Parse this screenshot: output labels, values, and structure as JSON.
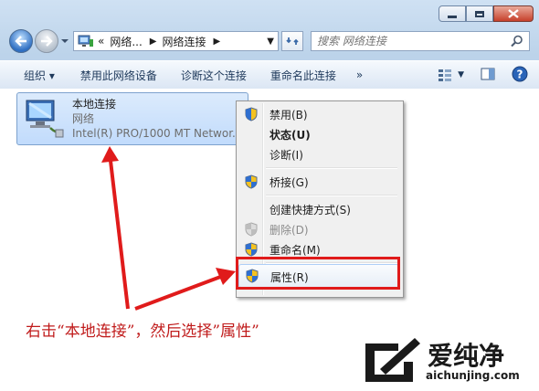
{
  "window": {
    "min_label": "",
    "max_label": "",
    "close_label": ""
  },
  "address": {
    "prefix": "«",
    "crumbs": [
      "网络...",
      "网络连接"
    ]
  },
  "search": {
    "placeholder": "搜索 网络连接"
  },
  "toolbar": {
    "organize": "组织 ▾",
    "disable": "禁用此网络设备",
    "diagnose": "诊断这个连接",
    "rename": "重命名此连接",
    "more": "»"
  },
  "connection": {
    "name": "本地连接",
    "network": "网络",
    "adapter": "Intel(R) PRO/1000 MT Networ..."
  },
  "menu": {
    "items": [
      {
        "label": "禁用(B)"
      },
      {
        "label": "状态(U)"
      },
      {
        "label": "诊断(I)"
      },
      {
        "label": "桥接(G)"
      },
      {
        "label": "创建快捷方式(S)"
      },
      {
        "label": "删除(D)"
      },
      {
        "label": "重命名(M)"
      },
      {
        "label": "属性(R)"
      }
    ]
  },
  "annotation": {
    "text": "右击“本地连接”，然后选择”属性”"
  },
  "watermark": {
    "brand": "爱纯净",
    "url": "aichunjing.com"
  },
  "colors": {
    "annotation_red": "#e01b1b",
    "accent_blue": "#2f6fc2"
  }
}
